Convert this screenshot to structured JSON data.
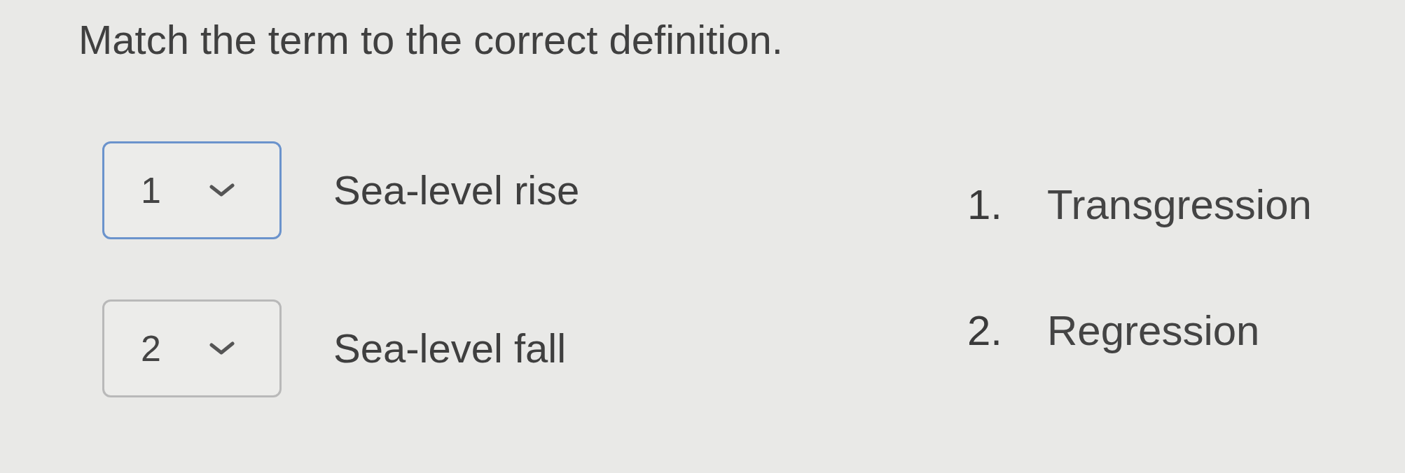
{
  "instruction": "Match the term to the correct definition.",
  "terms": [
    {
      "answer": "1",
      "focused": true,
      "term": "Sea-level rise"
    },
    {
      "answer": "2",
      "focused": false,
      "term": "Sea-level fall"
    }
  ],
  "definitions": [
    {
      "number": "1.",
      "text": "Transgression"
    },
    {
      "number": "2.",
      "text": "Regression"
    }
  ]
}
